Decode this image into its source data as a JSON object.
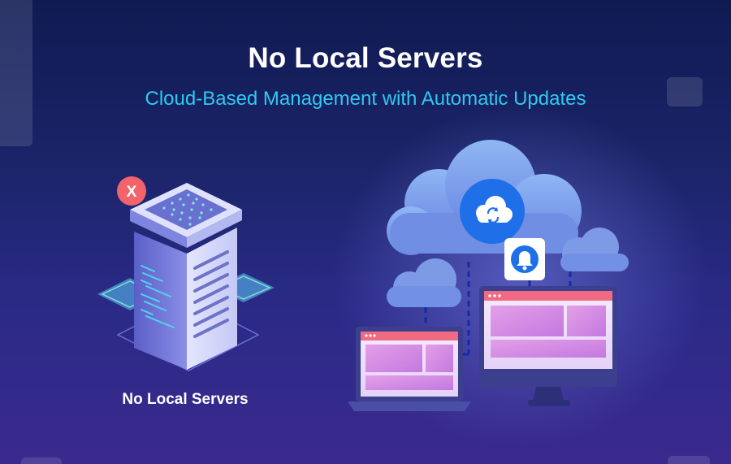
{
  "header": {
    "title": "No Local Servers",
    "subtitle": "Cloud-Based Management with Automatic Updates"
  },
  "server_illustration": {
    "caption": "No Local Servers",
    "badge_text": "X",
    "badge_color": "#f2636b"
  },
  "cloud_illustration": {
    "sync_icon": "cloud-sync-icon",
    "notification_icon": "bell-icon",
    "devices": [
      "laptop",
      "desktop-monitor"
    ]
  },
  "colors": {
    "accent": "#2fc9f2",
    "background_top": "#101a52",
    "background_bottom": "#3a2a8e"
  }
}
